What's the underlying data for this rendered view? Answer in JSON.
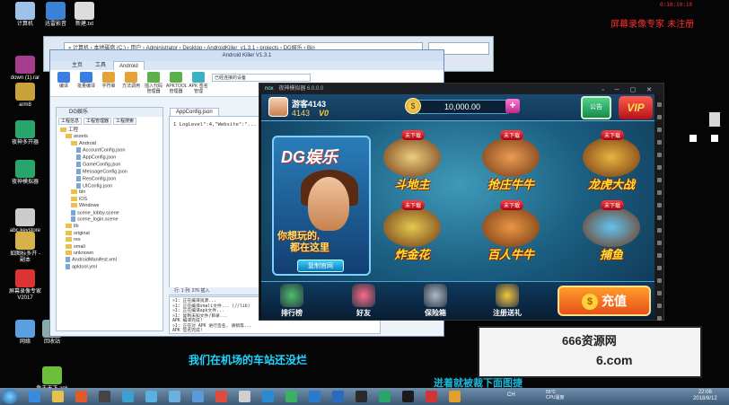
{
  "recorder": {
    "title": "屏幕录像专家 未注册",
    "time": "0:10:10:10"
  },
  "desktop_icons": [
    {
      "label": "计算机",
      "color": "#9fc3e8"
    },
    {
      "label": "迅雷影音",
      "color": "#3b82d6"
    },
    {
      "label": "新建.txt",
      "color": "#dddddd"
    },
    {
      "label": "down (1).rar",
      "color": "#a63c8c"
    },
    {
      "label": "arm8",
      "color": "#c9a23b"
    },
    {
      "label": "夜神多开器",
      "color": "#27a56a"
    },
    {
      "label": "夜神模拟器",
      "color": "#27a56a"
    },
    {
      "label": "abc.keystore",
      "color": "#cccccc"
    },
    {
      "label": "如图标多开 - 副本",
      "color": "#d7b24a"
    },
    {
      "label": "屏幕录像专家V2017",
      "color": "#d33"
    },
    {
      "label": "网络",
      "color": "#5aa0e0"
    },
    {
      "label": "回收站",
      "color": "#8aa"
    },
    {
      "label": "鱼王天下.apk",
      "color": "#6cbf3a"
    }
  ],
  "explorer": {
    "path": "« 计算机 › 本地磁盘 (C:) › 用户 › Administrator › Desktop › AndroidKiller_v1.3.1 › projects › DG娱乐 › Bin",
    "menu_file": "文件"
  },
  "android_killer": {
    "title": "Android Killer V1.3.1",
    "tabs": [
      "主页",
      "工具",
      "Android"
    ],
    "active_tab": "Android",
    "ribbon": [
      {
        "label": "编译",
        "color": "#3b7de0"
      },
      {
        "label": "批量编译",
        "color": "#3b7de0"
      },
      {
        "label": "字符串",
        "color": "#e5a23a"
      },
      {
        "label": "方法调用",
        "color": "#e5a23a"
      },
      {
        "label": "插入代码管理器",
        "color": "#5bb04a"
      },
      {
        "label": "APKTOOL管理器",
        "color": "#5bb04a"
      },
      {
        "label": "APK 签名管理",
        "color": "#3ab0c0"
      }
    ],
    "device_label": "已经连接的设备",
    "project_tab": "DG娱乐",
    "project_buttons": [
      "工程信息",
      "工程管理器",
      "工程搜索"
    ],
    "tree": [
      {
        "label": "工程",
        "indent": 0,
        "kind": "folder"
      },
      {
        "label": "assets",
        "indent": 1,
        "kind": "folder"
      },
      {
        "label": "Android",
        "indent": 2,
        "kind": "folder"
      },
      {
        "label": "AccountConfig.json",
        "indent": 3,
        "kind": "file"
      },
      {
        "label": "AppConfig.json",
        "indent": 3,
        "kind": "file"
      },
      {
        "label": "GameConfig.json",
        "indent": 3,
        "kind": "file"
      },
      {
        "label": "MessageConfig.json",
        "indent": 3,
        "kind": "file"
      },
      {
        "label": "ResConfig.json",
        "indent": 3,
        "kind": "file"
      },
      {
        "label": "UIConfig.json",
        "indent": 3,
        "kind": "file"
      },
      {
        "label": "bin",
        "indent": 2,
        "kind": "folder"
      },
      {
        "label": "iOS",
        "indent": 2,
        "kind": "folder"
      },
      {
        "label": "Windows",
        "indent": 2,
        "kind": "folder"
      },
      {
        "label": "scene_lobby.scene",
        "indent": 2,
        "kind": "file"
      },
      {
        "label": "scene_login.scene",
        "indent": 2,
        "kind": "file"
      },
      {
        "label": "lib",
        "indent": 1,
        "kind": "folder"
      },
      {
        "label": "original",
        "indent": 1,
        "kind": "folder"
      },
      {
        "label": "res",
        "indent": 1,
        "kind": "folder"
      },
      {
        "label": "smali",
        "indent": 1,
        "kind": "folder"
      },
      {
        "label": "unknown",
        "indent": 1,
        "kind": "folder"
      },
      {
        "label": "AndroidManifest.xml",
        "indent": 1,
        "kind": "file"
      },
      {
        "label": "apktool.yml",
        "indent": 1,
        "kind": "file"
      }
    ],
    "editor_tab": "AppConfig.json",
    "code_line": "1  LogLevel\":4,\"Website\":\"...",
    "status": "行: 1    列: 276    插入",
    "log": [
      "»1: 正在编译资源...",
      "»1: 正在编译smali文件... (//lib)",
      "»1: 正在编译apk文件...",
      "»1: 复制未知文件/目录...",
      "APK 编译完成!",
      "»1: 正在对 APK 进行签名, 请稍等...",
      "APK 签名完成!",
      "=================================",
      "APK 所有编译工作全部完成!!!",
      "生成路径:",
      "file:C:\\Users\\Administrator\\Deskt..."
    ],
    "log_tabs": [
      "日志输出",
      "方法引用"
    ]
  },
  "emulator": {
    "title": "夜神模拟器 6.0.0.0",
    "logo": "nox"
  },
  "game": {
    "username": "游客4143",
    "user_id": "4143",
    "vip_small": "V0",
    "coins": "10,000.00",
    "coin_symbol": "$",
    "plus": "+",
    "notice_label": "公告",
    "vip_label": "VIP",
    "promo": {
      "brand": "DG娱乐",
      "slogan_line1": "你想玩的,",
      "slogan_line2": "都在这里",
      "copy_button": "复制官网"
    },
    "badge": "未下载",
    "games": [
      {
        "name": "斗地主",
        "color": "#ffd77a"
      },
      {
        "name": "抢庄牛牛",
        "color": "#ff9f4a"
      },
      {
        "name": "龙虎大战",
        "color": "#ffbf3a"
      },
      {
        "name": "炸金花",
        "color": "#f7d24a"
      },
      {
        "name": "百人牛牛",
        "color": "#ff9a3a"
      },
      {
        "name": "捕鱼",
        "color": "#6ad0ff"
      }
    ],
    "bottom_nav": [
      {
        "label": "排行榜",
        "color": "#4cc06a"
      },
      {
        "label": "好友",
        "color": "#ff6a8a"
      },
      {
        "label": "保险箱",
        "color": "#b0b8c8"
      },
      {
        "label": "注册送礼",
        "color": "#f5c53a"
      }
    ],
    "recharge_label": "充值",
    "recharge_symbol": "$"
  },
  "subtitle_1": "我们在机场的车站还没烂",
  "subtitle_2": "迸着就被裁下面图捷",
  "watermark": {
    "line1": "666资源网",
    "line2": "6.com"
  },
  "taskbar": {
    "apps": [
      {
        "name": "ie-icon",
        "color": "#3a8ae0"
      },
      {
        "name": "folder-icon",
        "color": "#e8c14a"
      },
      {
        "name": "media-icon",
        "color": "#e05a2a"
      },
      {
        "name": "g-icon",
        "color": "#444444"
      },
      {
        "name": "browser-icon",
        "color": "#3aa0d0"
      },
      {
        "name": "ie2-icon",
        "color": "#5ab0e0"
      },
      {
        "name": "bird-icon",
        "color": "#6ab0e0"
      },
      {
        "name": "apps-icon",
        "color": "#5a9ad8"
      },
      {
        "name": "chrome-icon",
        "color": "#e04a3a"
      },
      {
        "name": "tool-icon",
        "color": "#cfcfcf"
      },
      {
        "name": "qq-icon",
        "color": "#2a8ad0"
      },
      {
        "name": "wps-icon",
        "color": "#3ab060"
      },
      {
        "name": "edge-icon",
        "color": "#2a7ad0"
      },
      {
        "name": "thunder-icon",
        "color": "#2a6ac0"
      },
      {
        "name": "game-icon",
        "color": "#2a2a2a"
      },
      {
        "name": "nox-icon",
        "color": "#27a56a"
      },
      {
        "name": "ak-icon",
        "color": "#1a1a1a"
      },
      {
        "name": "recorder-icon",
        "color": "#d33333"
      },
      {
        "name": "player-icon",
        "color": "#e0a02a"
      }
    ],
    "lang": "CH",
    "cpu": "55°C",
    "cpu_label": "CPU温度",
    "time": "22:06",
    "date": "2018/8/12"
  }
}
